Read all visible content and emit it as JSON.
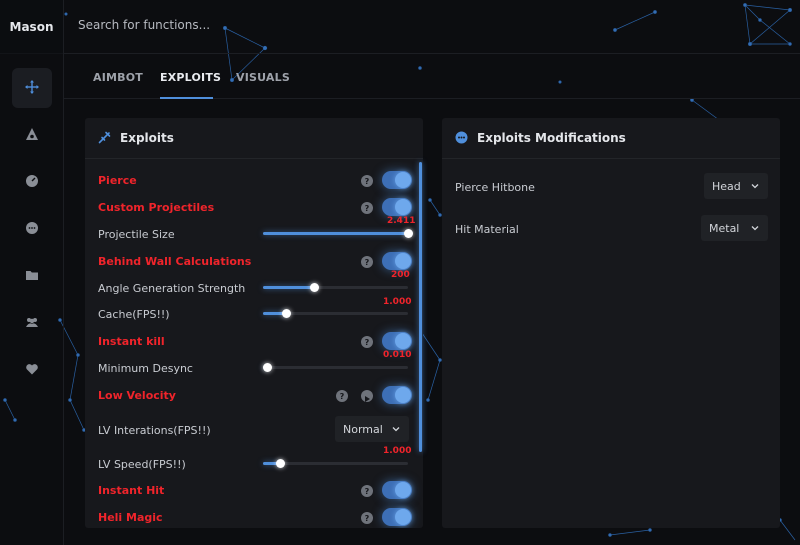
{
  "app": {
    "brand": "Mason"
  },
  "search": {
    "placeholder": "Search for functions..."
  },
  "sidebar": {
    "items": [
      {
        "icon": "move-icon",
        "active": true
      },
      {
        "icon": "eye-triangle-icon",
        "active": false
      },
      {
        "icon": "gauge-icon",
        "active": false
      },
      {
        "icon": "chat-bubble-icon",
        "active": false
      },
      {
        "icon": "folder-icon",
        "active": false
      },
      {
        "icon": "users-icon",
        "active": false
      },
      {
        "icon": "heart-icon",
        "active": false
      }
    ]
  },
  "tabs": [
    {
      "label": "AIMBOT",
      "active": false
    },
    {
      "label": "EXPLOITS",
      "active": true
    },
    {
      "label": "VISUALS",
      "active": false
    }
  ],
  "exploits_panel": {
    "title": "Exploits",
    "icon": "syringe-icon",
    "rows": {
      "pierce": {
        "label": "Pierce",
        "enabled": true
      },
      "custom_projectiles": {
        "label": "Custom Projectiles",
        "enabled": true
      },
      "projectile_size": {
        "label": "Projectile Size",
        "value": "2.411",
        "fraction": 1.0
      },
      "behind_wall": {
        "label": "Behind Wall Calculations",
        "enabled": true
      },
      "angle_gen": {
        "label": "Angle Generation Strength",
        "value": "200",
        "fraction": 0.35
      },
      "cache": {
        "label": "Cache(FPS!!)",
        "value": "1.000",
        "fraction": 0.16
      },
      "instant_kill": {
        "label": "Instant kill",
        "enabled": true
      },
      "min_desync": {
        "label": "Minimum Desync",
        "value": "0.010",
        "fraction": 0.03
      },
      "low_velocity": {
        "label": "Low Velocity",
        "enabled": true
      },
      "lv_iterations": {
        "label": "LV Interations(FPS!!)",
        "selected": "Normal"
      },
      "lv_speed": {
        "label": "LV Speed(FPS!!)",
        "value": "1.000",
        "fraction": 0.12
      },
      "instant_hit": {
        "label": "Instant Hit",
        "enabled": true
      },
      "heli_magic": {
        "label": "Heli Magic",
        "enabled": true
      }
    }
  },
  "mods_panel": {
    "title": "Exploits Modifications",
    "icon": "dots-circle-icon",
    "pierce_hitbone": {
      "label": "Pierce Hitbone",
      "selected": "Head"
    },
    "hit_material": {
      "label": "Hit Material",
      "selected": "Metal"
    }
  },
  "colors": {
    "accent": "#4f8fdc",
    "danger_label": "#f0242b",
    "panel": "#17181c",
    "background": "#0c0d10"
  }
}
